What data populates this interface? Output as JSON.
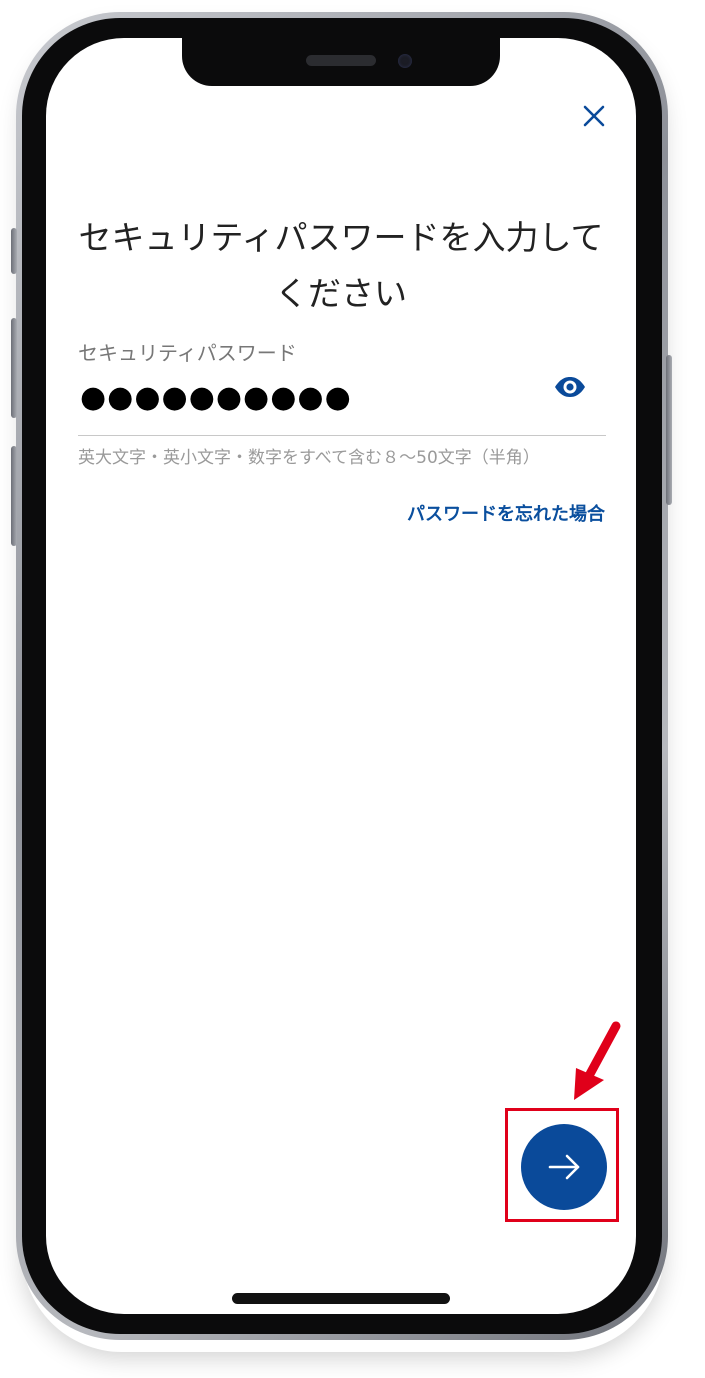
{
  "screen": {
    "title": "セキュリティパスワードを入力してください"
  },
  "password_field": {
    "label": "セキュリティパスワード",
    "masked_value": "●●●●●●●●●●",
    "hint": "英大文字・英小文字・数字をすべて含む８～50文字（半角）"
  },
  "links": {
    "forgot_password": "パスワードを忘れた場合"
  },
  "colors": {
    "accent_blue": "#0a4a9a",
    "callout_red": "#e0001a",
    "title_text": "#222222",
    "label_text": "#777777",
    "hint_text": "#9a9a9a"
  },
  "icons": {
    "close": "close-icon",
    "toggle_visibility": "eye-icon",
    "next": "arrow-right-icon",
    "callout": "red-arrow-icon"
  }
}
